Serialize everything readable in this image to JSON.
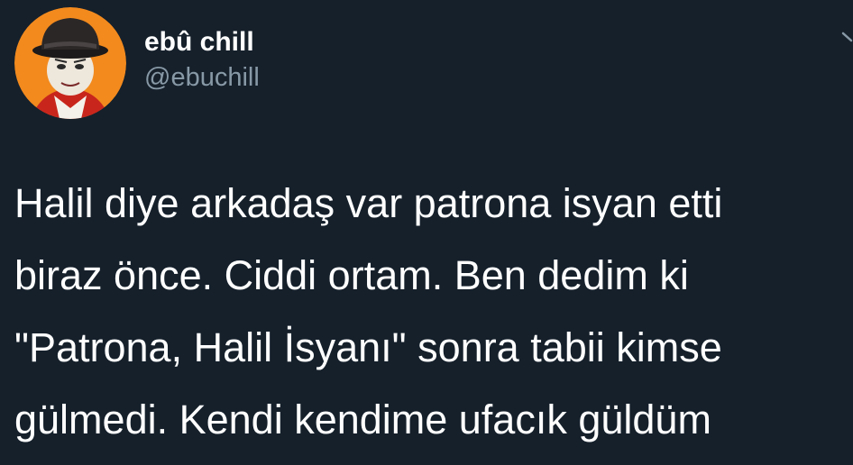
{
  "tweet": {
    "author": {
      "display_name": "ebû chill",
      "handle": "@ebuchill"
    },
    "text_lines": [
      "Halil diye arkadaş var patrona isyan etti",
      "biraz önce. Ciddi ortam. Ben dedim ki",
      "\"Patrona, Halil İsyanı\" sonra tabii kimse",
      "gülmedi. Kendi kendime ufacık güldüm"
    ]
  },
  "icons": {
    "avatar": "profile-avatar",
    "menu": "chevron-down-icon"
  },
  "colors": {
    "background": "#15202b",
    "text": "#ffffff",
    "secondary_text": "#8899a6",
    "avatar_bg": "#f28a1e"
  }
}
